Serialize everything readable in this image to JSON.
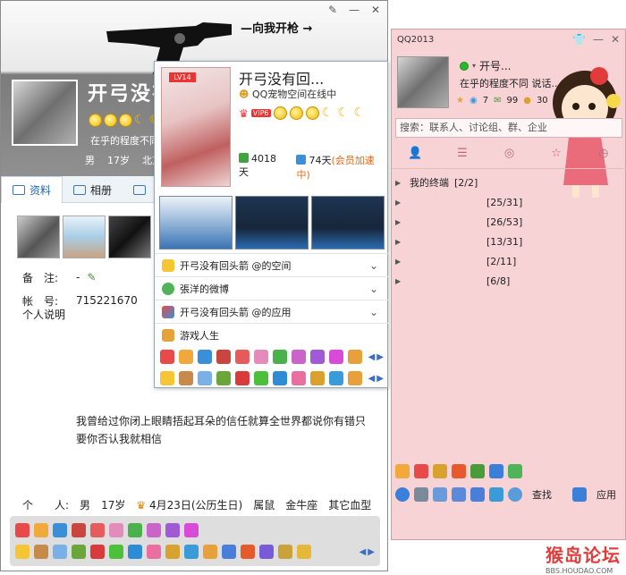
{
  "profile": {
    "banner": "—向我开枪 →",
    "nickname": "开弓没有",
    "signature": "在乎的程度不同",
    "basic": [
      "男",
      "17岁",
      "北京"
    ],
    "tabs": [
      {
        "label": "资料"
      },
      {
        "label": "相册"
      },
      {
        "label": ""
      }
    ],
    "fields": [
      {
        "label": "备　注:",
        "value": "-"
      },
      {
        "label": "帐　号:",
        "value": "715221670"
      }
    ],
    "bio_label": "个人说明",
    "bio": "我曾给过你闭上眼睛捂起耳朵的信任就算全世界都说你有错只要你否认我就相信",
    "personal": {
      "label": "个　　人:",
      "gender": "男",
      "age": "17岁",
      "birthday": "4月23日(公历生日)",
      "zodiac": "属鼠",
      "constellation": "金牛座",
      "blood": "其它血型"
    }
  },
  "card": {
    "level": "LV14",
    "name": "开弓没有回...",
    "status": "QQ宠物空间在线中",
    "vip": "VIP6",
    "days_online": "4018天",
    "days_active": "74天",
    "boost": "(会员加速中)",
    "items": [
      {
        "label": "开弓没有回头箭 @的空间"
      },
      {
        "label": "張洋的微博"
      },
      {
        "label": "开弓没有回头箭 @的应用"
      },
      {
        "label": "游戏人生"
      }
    ]
  },
  "qq": {
    "title": "QQ2013",
    "nickname": "开号...",
    "signature": "在乎的程度不同 说话...",
    "counts": [
      "7",
      "99",
      "30"
    ],
    "search_placeholder": "搜索：联系人、讨论组、群、企业",
    "groups": [
      {
        "name": "我的终端",
        "count": "[2/2]",
        "indent": false
      },
      {
        "name": "",
        "count": "[25/31]",
        "indent": true
      },
      {
        "name": "",
        "count": "[26/53]",
        "indent": true
      },
      {
        "name": "",
        "count": "[13/31]",
        "indent": true
      },
      {
        "name": "",
        "count": "[2/11]",
        "indent": true
      },
      {
        "name": "",
        "count": "[6/8]",
        "indent": true
      }
    ],
    "bottom": {
      "find": "查找",
      "apps": "应用"
    }
  },
  "watermark": {
    "big": "猴岛论坛",
    "small": "BBS.HOUDAO.COM"
  },
  "colors": {
    "accent": "#1f67b3",
    "pink": "#f8d3d6",
    "red": "#e33333"
  }
}
